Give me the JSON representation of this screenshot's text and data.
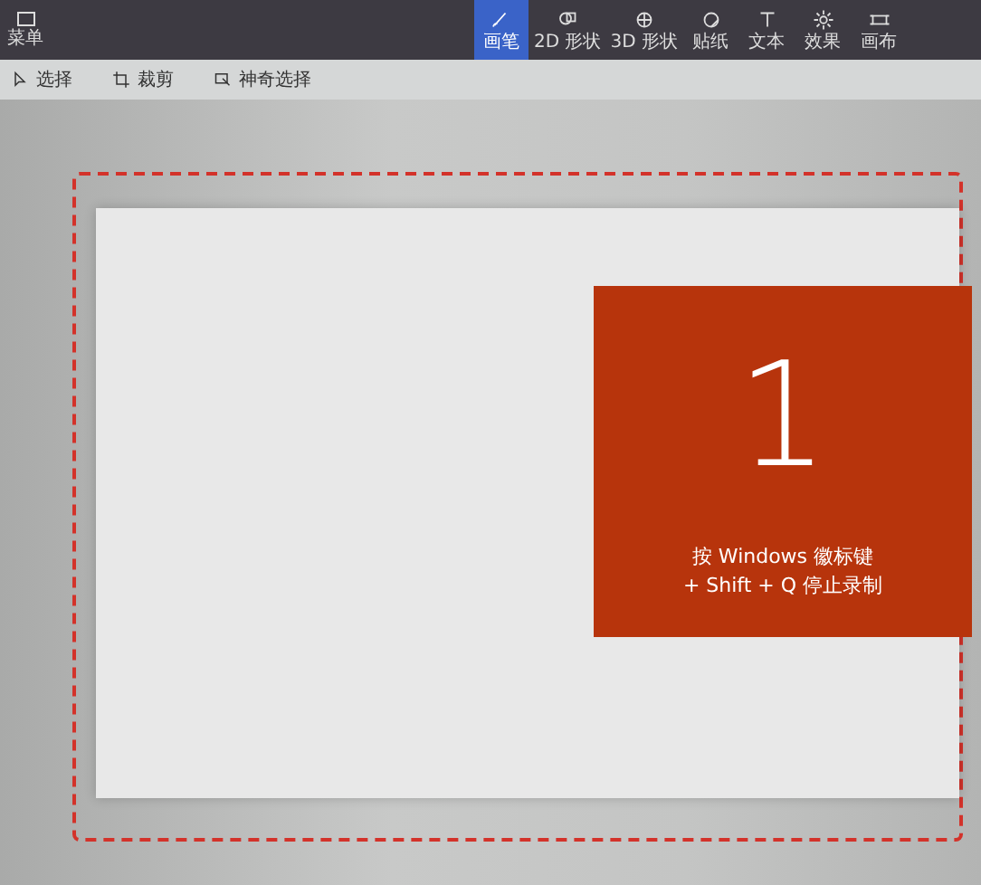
{
  "menu_button": {
    "label": "菜单"
  },
  "tools": [
    {
      "label": "画笔",
      "selected": true,
      "kind": "brush"
    },
    {
      "label": "2D 形状",
      "selected": false,
      "kind": "shape2d"
    },
    {
      "label": "3D 形状",
      "selected": false,
      "kind": "shape3d"
    },
    {
      "label": "贴纸",
      "selected": false,
      "kind": "sticker"
    },
    {
      "label": "文本",
      "selected": false,
      "kind": "text"
    },
    {
      "label": "效果",
      "selected": false,
      "kind": "effects"
    },
    {
      "label": "画布",
      "selected": false,
      "kind": "canvas"
    }
  ],
  "subtoolbar": [
    {
      "label": "选择",
      "kind": "select"
    },
    {
      "label": "裁剪",
      "kind": "crop"
    },
    {
      "label": "神奇选择",
      "kind": "magic"
    }
  ],
  "countdown": {
    "number": "1",
    "hint_line_1": "按 Windows 徽标键",
    "hint_line_2": "+ Shift + Q 停止录制"
  }
}
